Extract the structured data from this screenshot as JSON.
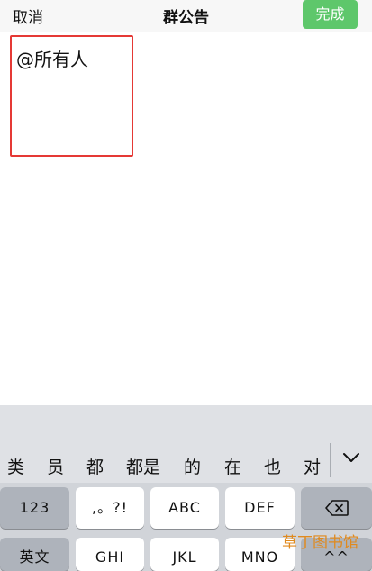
{
  "navbar": {
    "cancel_label": "取消",
    "title": "群公告",
    "done_label": "完成"
  },
  "editor": {
    "text": "@所有人"
  },
  "keyboard": {
    "candidates": [
      "类",
      "员",
      "都",
      "都是",
      "的",
      "在",
      "也",
      "对"
    ],
    "collapse_icon": "chevron-down-icon",
    "keys": {
      "num": "123",
      "punct": ",。?!",
      "abc": "ABC",
      "def": "DEF",
      "lang": "英文",
      "ghi": "GHI",
      "jkl": "JKL",
      "mno": "MNO",
      "emoji": "^^"
    },
    "backspace_icon": "backspace-icon"
  },
  "watermark": {
    "text": "草丁图书馆"
  },
  "colors": {
    "done_button": "#5ec76b",
    "highlight_box": "#e53935",
    "keyboard_bg": "#d1d4d9"
  }
}
